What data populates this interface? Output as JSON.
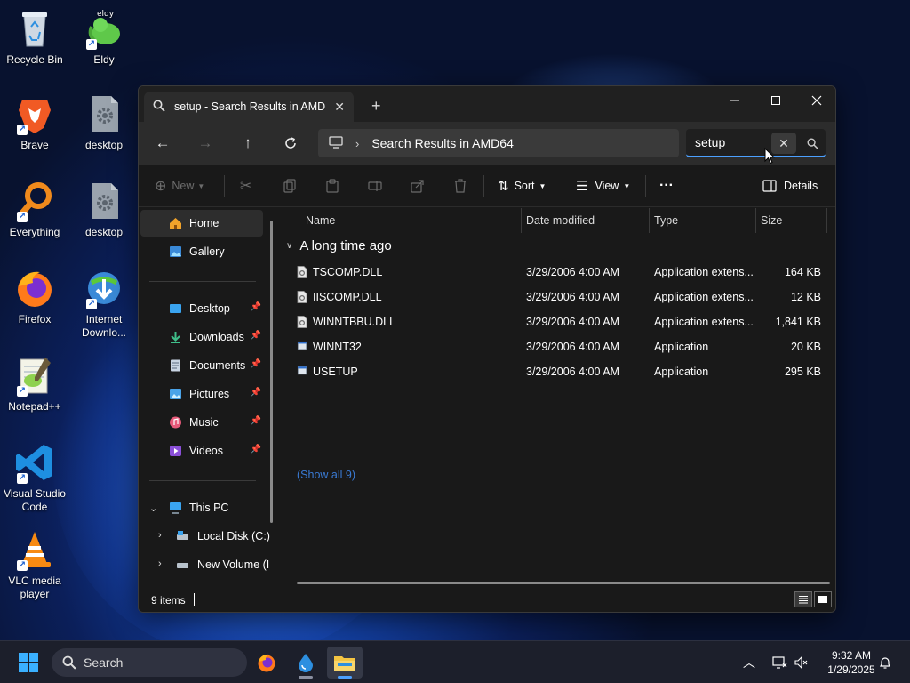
{
  "desktop": {
    "icons": [
      {
        "label": "Recycle Bin",
        "icon": "recycle-bin-icon"
      },
      {
        "label": "Eldy",
        "icon": "eldy-icon"
      },
      {
        "label": "Brave",
        "icon": "brave-icon"
      },
      {
        "label": "desktop",
        "icon": "settings-file-icon"
      },
      {
        "label": "Everything",
        "icon": "everything-search-icon"
      },
      {
        "label": "desktop",
        "icon": "settings-file-icon"
      },
      {
        "label": "Firefox",
        "icon": "firefox-icon"
      },
      {
        "label": "Internet Downlo...",
        "icon": "internet-download-manager-icon"
      },
      {
        "label": "Notepad++",
        "icon": "notepad-plus-plus-icon"
      },
      {
        "label": "Visual Studio Code",
        "icon": "vscode-icon"
      },
      {
        "label": "VLC media player",
        "icon": "vlc-icon"
      }
    ]
  },
  "explorer": {
    "tab_title": "setup - Search Results in AMD",
    "breadcrumb": "Search Results in AMD64",
    "search_value": "setup",
    "toolbar": {
      "new_label": "New",
      "sort_label": "Sort",
      "view_label": "View",
      "more_label": "···",
      "details_label": "Details"
    },
    "sidebar": {
      "home": "Home",
      "gallery": "Gallery",
      "desktop": "Desktop",
      "downloads": "Downloads",
      "documents": "Documents",
      "pictures": "Pictures",
      "music": "Music",
      "videos": "Videos",
      "this_pc": "This PC",
      "local_disk": "Local Disk (C:)",
      "new_volume": "New Volume (I"
    },
    "columns": {
      "name": "Name",
      "date": "Date modified",
      "type": "Type",
      "size": "Size"
    },
    "group_label": "A long time ago",
    "files": [
      {
        "name": "TSCOMP.DLL",
        "date": "3/29/2006 4:00 AM",
        "type": "Application extens...",
        "size": "164 KB",
        "kind": "dll"
      },
      {
        "name": "IISCOMP.DLL",
        "date": "3/29/2006 4:00 AM",
        "type": "Application extens...",
        "size": "12 KB",
        "kind": "dll"
      },
      {
        "name": "WINNTBBU.DLL",
        "date": "3/29/2006 4:00 AM",
        "type": "Application extens...",
        "size": "1,841 KB",
        "kind": "dll"
      },
      {
        "name": "WINNT32",
        "date": "3/29/2006 4:00 AM",
        "type": "Application",
        "size": "20 KB",
        "kind": "exe"
      },
      {
        "name": "USETUP",
        "date": "3/29/2006 4:00 AM",
        "type": "Application",
        "size": "295 KB",
        "kind": "exe"
      }
    ],
    "show_all": "(Show all 9)",
    "status": "9 items"
  },
  "taskbar": {
    "search_label": "Search",
    "time": "9:32 AM",
    "date": "1/29/2025"
  },
  "colors": {
    "accent": "#4ca0ff",
    "link": "#3a7bd5",
    "window_bg": "#191919",
    "taskbar_bg": "#1c1f2b"
  }
}
